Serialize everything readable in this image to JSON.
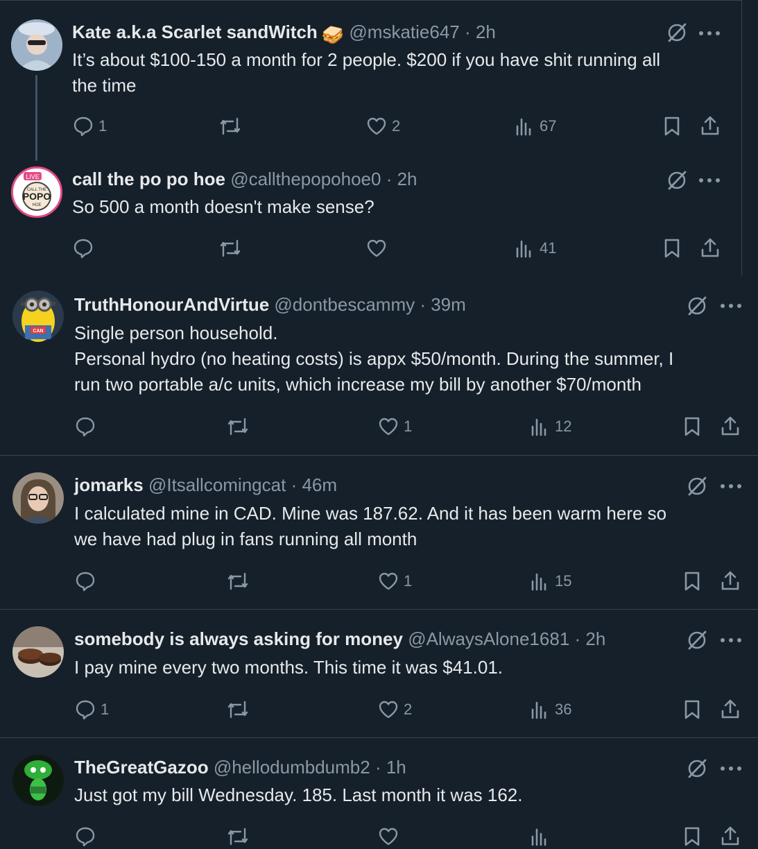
{
  "tweets": [
    {
      "name": "Kate a.k.a Scarlet sandWitch",
      "badge_emoji": "🥪",
      "handle": "@mskatie647",
      "time": "· 2h",
      "lines": [
        "It’s about $100-150 a month for 2 people. $200 if you have shit running all",
        "the time"
      ],
      "replies": "1",
      "retweets": "",
      "likes": "2",
      "views": "67"
    },
    {
      "name": "call the po po hoe",
      "handle": "@callthepopohoe0",
      "time": "· 2h",
      "lines": [
        "So 500 a month doesn't make sense?"
      ],
      "replies": "",
      "retweets": "",
      "likes": "",
      "views": "41",
      "avatar_text": {
        "live": "LIVE",
        "top": "CALL THE",
        "mid": "POPO",
        "bot": "HOE"
      }
    },
    {
      "name": "TruthHonourAndVirtue",
      "handle": "@dontbescammy",
      "time": "· 39m",
      "lines": [
        "Single person household.",
        "Personal hydro (no heating costs) is appx $50/month. During the summer, I",
        "run two portable a/c units, which increase my bill by another $70/month"
      ],
      "replies": "",
      "retweets": "",
      "likes": "1",
      "views": "12",
      "avatar_text": {
        "badge": "CAN"
      }
    },
    {
      "name": "jomarks",
      "handle": "@Itsallcomingcat",
      "time": "· 46m",
      "lines": [
        "I calculated mine in CAD.  Mine was 187.62.  And it has been warm here so",
        "we have had plug in fans running all month"
      ],
      "replies": "",
      "retweets": "",
      "likes": "1",
      "views": "15"
    },
    {
      "name": "somebody is always asking for money",
      "handle": "@AlwaysAlone1681",
      "time": "· 2h",
      "lines": [
        "I pay mine every two months. This time it was $41.01."
      ],
      "replies": "1",
      "retweets": "",
      "likes": "2",
      "views": "36"
    },
    {
      "name": "TheGreatGazoo",
      "handle": "@hellodumbdumb2",
      "time": "· 1h",
      "lines": [
        "Just got my bill Wednesday.  185. Last month it was 162."
      ],
      "replies": "",
      "retweets": "",
      "likes": "",
      "views": ""
    }
  ],
  "colors": {
    "background": "#15202b",
    "text": "#e7e9ea",
    "muted": "#8b98a5",
    "divider": "#38444d"
  },
  "icons": [
    "reply-icon",
    "retweet-icon",
    "like-icon",
    "views-icon",
    "bookmark-icon",
    "share-icon",
    "grok-icon",
    "more-icon"
  ]
}
